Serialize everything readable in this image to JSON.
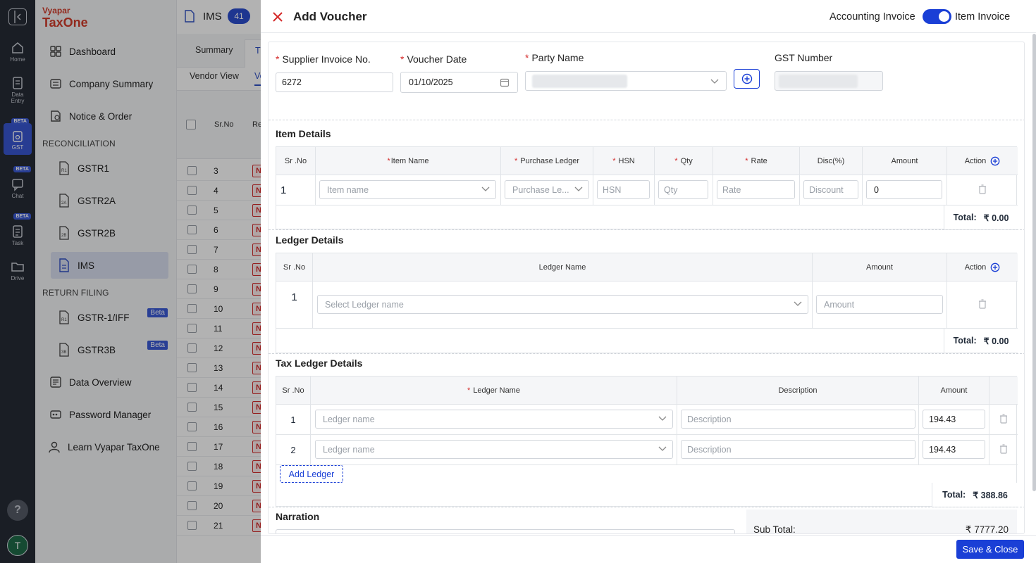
{
  "rail": {
    "items": [
      {
        "label": "Home",
        "icon": "home-icon"
      },
      {
        "label": "Data",
        "label2": "Entry",
        "icon": "data-entry-icon"
      },
      {
        "label": "GST",
        "icon": "gst-icon",
        "badge": "BETA",
        "active": true
      },
      {
        "label": "Chat",
        "icon": "chat-icon",
        "badge": "BETA"
      },
      {
        "label": "Task",
        "icon": "task-icon",
        "badge": "BETA"
      },
      {
        "label": "Drive",
        "icon": "drive-icon"
      }
    ],
    "help": "?",
    "avatar": "T"
  },
  "sidebar": {
    "brand_top": "Vyapar",
    "brand_bottom": "TaxOne",
    "items": [
      {
        "label": "Dashboard"
      },
      {
        "label": "Company Summary"
      },
      {
        "label": "Notice & Order"
      }
    ],
    "reconciliation_heading": "RECONCILIATION",
    "reconciliation_items": [
      {
        "label": "GSTR1",
        "tag": "R1"
      },
      {
        "label": "GSTR2A",
        "tag": "2A"
      },
      {
        "label": "GSTR2B",
        "tag": "2B"
      },
      {
        "label": "IMS",
        "active": true
      }
    ],
    "return_heading": "RETURN FILING",
    "return_items": [
      {
        "label": "GSTR-1/IFF",
        "tag": "R1",
        "beta": "Beta"
      },
      {
        "label": "GSTR3B",
        "tag": "3B",
        "beta": "Beta"
      }
    ],
    "bottom_items": [
      {
        "label": "Data Overview"
      },
      {
        "label": "Password Manager"
      },
      {
        "label": "Learn Vyapar TaxOne"
      }
    ]
  },
  "background_page": {
    "title": "IMS",
    "count": "41",
    "tabs": [
      "Summary",
      "Tr"
    ],
    "subtabs": [
      "Vendor View",
      "Ve"
    ],
    "col_srno": "Sr.No",
    "col_next": "Re",
    "rows": [
      "3",
      "4",
      "5",
      "6",
      "7",
      "8",
      "9",
      "10",
      "11",
      "12",
      "13",
      "14",
      "15",
      "16",
      "17",
      "18",
      "19",
      "20",
      "21"
    ],
    "row_badge": "N"
  },
  "voucher": {
    "title": "Add Voucher",
    "toggle_left": "Accounting Invoice",
    "toggle_right": "Item Invoice",
    "supplier_invoice_label": "Supplier Invoice No.",
    "supplier_invoice_value": "6272",
    "voucher_date_label": "Voucher Date",
    "voucher_date_value": "01/10/2025",
    "party_name_label": "Party Name",
    "gst_number_label": "GST Number",
    "item_details": {
      "heading": "Item Details",
      "headers": [
        "Sr .No",
        "Item Name",
        "Purchase Ledger",
        "HSN",
        "Qty",
        "Rate",
        "Disc(%)",
        "Amount",
        "Action"
      ],
      "row_no": "1",
      "placeholders": {
        "item": "Item name",
        "ledger": "Purchase Le...",
        "hsn": "HSN",
        "qty": "Qty",
        "rate": "Rate",
        "discount": "Discount"
      },
      "amount_value": "0",
      "total_label": "Total:",
      "total_value": "₹ 0.00"
    },
    "ledger_details": {
      "heading": "Ledger Details",
      "headers": [
        "Sr .No",
        "Ledger Name",
        "Amount",
        "Action"
      ],
      "row_no": "1",
      "ledger_placeholder": "Select Ledger name",
      "amount_placeholder": "Amount",
      "total_label": "Total:",
      "total_value": "₹ 0.00"
    },
    "tax_ledger_details": {
      "heading": "Tax Ledger Details",
      "headers": [
        "Sr .No",
        "Ledger Name",
        "Description",
        "Amount"
      ],
      "rows": [
        {
          "no": "1",
          "ledger_placeholder": "Ledger name",
          "description_placeholder": "Description",
          "amount": "194.43"
        },
        {
          "no": "2",
          "ledger_placeholder": "Ledger name",
          "description_placeholder": "Description",
          "amount": "194.43"
        }
      ],
      "add_ledger": "Add Ledger",
      "total_label": "Total:",
      "total_value": "₹ 388.86"
    },
    "narration_label": "Narration",
    "sub_total_label": "Sub Total:",
    "sub_total_value": "₹ 7777.20",
    "save_close": "Save & Close",
    "colors": {
      "accent": "#1a3fd6",
      "required": "#d52b2b",
      "close": "#d52b2b"
    }
  }
}
